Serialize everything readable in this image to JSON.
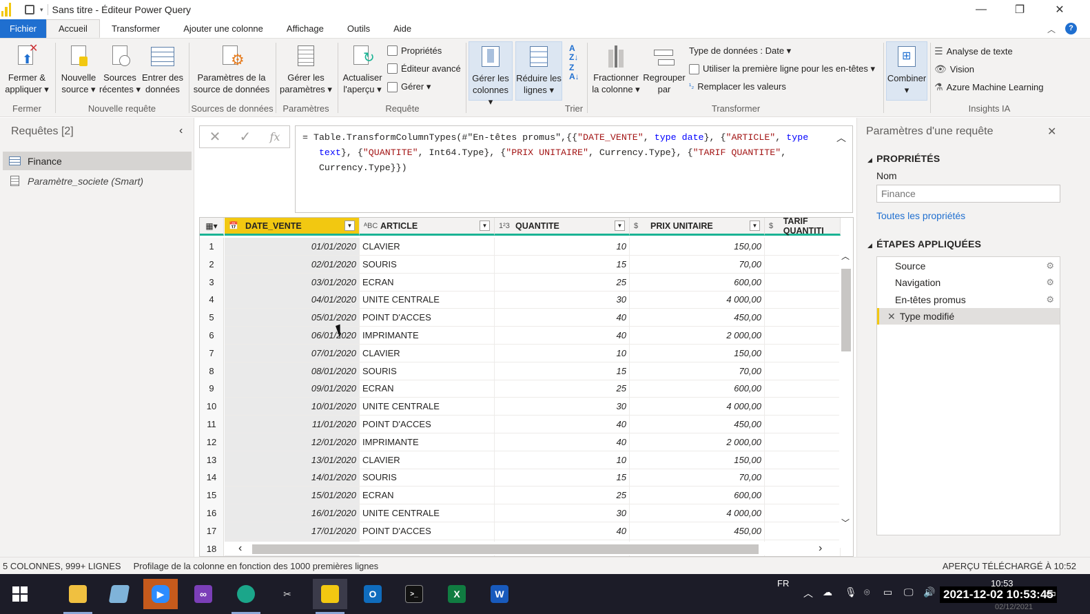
{
  "window": {
    "title": "Sans titre - Éditeur Power Query",
    "save_icon": "save-icon",
    "controls": [
      "minimize",
      "restore",
      "close"
    ]
  },
  "tabs": [
    "Fichier",
    "Accueil",
    "Transformer",
    "Ajouter une colonne",
    "Affichage",
    "Outils",
    "Aide"
  ],
  "ribbon": {
    "close_apply": [
      "Fermer &",
      "appliquer ▾"
    ],
    "new_source": [
      "Nouvelle",
      "source ▾"
    ],
    "recent_sources": [
      "Sources",
      "récentes ▾"
    ],
    "enter_data": [
      "Entrer des",
      "données"
    ],
    "ds_settings": [
      "Paramètres de la",
      "source de données"
    ],
    "manage_params": [
      "Gérer les",
      "paramètres ▾"
    ],
    "refresh_preview": [
      "Actualiser",
      "l'aperçu ▾"
    ],
    "properties": "Propriétés",
    "advanced_editor": "Éditeur avancé",
    "manage": "Gérer ▾",
    "manage_cols": [
      "Gérer les",
      "colonnes ▾"
    ],
    "reduce_rows": [
      "Réduire les",
      "lignes ▾"
    ],
    "split_col": [
      "Fractionner",
      "la colonne ▾"
    ],
    "group_by": [
      "Regrouper",
      "par"
    ],
    "data_type": "Type de données : Date ▾",
    "first_row_headers": "Utiliser la première ligne pour les en-têtes ▾",
    "replace_values": "Remplacer les valeurs",
    "combine": [
      "Combiner",
      "▾"
    ],
    "text_analytics": "Analyse de texte",
    "vision": "Vision",
    "azure_ml": "Azure Machine Learning",
    "groups": {
      "close": "Fermer",
      "new_query": "Nouvelle requête",
      "data_sources": "Sources de données",
      "parameters": "Paramètres",
      "query": "Requête",
      "sort": "Trier",
      "transform": "Transformer",
      "ai_insights": "Insights IA"
    }
  },
  "queries": {
    "header": "Requêtes [2]",
    "items": [
      "Finance",
      "Paramètre_societe (Smart)"
    ]
  },
  "formula": {
    "prefix": "= ",
    "parts": [
      {
        "t": "Table.TransformColumnTypes(#\"En-têtes promus\",{{",
        "c": ""
      },
      {
        "t": "\"DATE_VENTE\"",
        "c": "st"
      },
      {
        "t": ", ",
        "c": ""
      },
      {
        "t": "type date",
        "c": "kw"
      },
      {
        "t": "}, {",
        "c": ""
      },
      {
        "t": "\"ARTICLE\"",
        "c": "st"
      },
      {
        "t": ", ",
        "c": ""
      },
      {
        "t": "type\n   text",
        "c": "kw"
      },
      {
        "t": "}, {",
        "c": ""
      },
      {
        "t": "\"QUANTITE\"",
        "c": "st"
      },
      {
        "t": ", Int64.Type}, {",
        "c": ""
      },
      {
        "t": "\"PRIX UNITAIRE\"",
        "c": "st"
      },
      {
        "t": ", Currency.Type}, {",
        "c": ""
      },
      {
        "t": "\"TARIF QUANTITE\"",
        "c": "st"
      },
      {
        "t": ",\n   Currency.Type}})",
        "c": ""
      }
    ]
  },
  "grid": {
    "columns": [
      {
        "type_icon": "📅",
        "name": "DATE_VENTE"
      },
      {
        "type_icon": "ᴬBC",
        "name": "ARTICLE"
      },
      {
        "type_icon": "1²3",
        "name": "QUANTITE"
      },
      {
        "type_icon": "$",
        "name": "PRIX UNITAIRE"
      },
      {
        "type_icon": "$",
        "name": "TARIF QUANTITI"
      }
    ],
    "rows": [
      [
        "1",
        "01/01/2020",
        "CLAVIER",
        "10",
        "150,00"
      ],
      [
        "2",
        "02/01/2020",
        "SOURIS",
        "15",
        "70,00"
      ],
      [
        "3",
        "03/01/2020",
        "ECRAN",
        "25",
        "600,00"
      ],
      [
        "4",
        "04/01/2020",
        "UNITE CENTRALE",
        "30",
        "4 000,00"
      ],
      [
        "5",
        "05/01/2020",
        "POINT D'ACCES",
        "40",
        "450,00"
      ],
      [
        "6",
        "06/01/2020",
        "IMPRIMANTE",
        "40",
        "2 000,00"
      ],
      [
        "7",
        "07/01/2020",
        "CLAVIER",
        "10",
        "150,00"
      ],
      [
        "8",
        "08/01/2020",
        "SOURIS",
        "15",
        "70,00"
      ],
      [
        "9",
        "09/01/2020",
        "ECRAN",
        "25",
        "600,00"
      ],
      [
        "10",
        "10/01/2020",
        "UNITE CENTRALE",
        "30",
        "4 000,00"
      ],
      [
        "11",
        "11/01/2020",
        "POINT D'ACCES",
        "40",
        "450,00"
      ],
      [
        "12",
        "12/01/2020",
        "IMPRIMANTE",
        "40",
        "2 000,00"
      ],
      [
        "13",
        "13/01/2020",
        "CLAVIER",
        "10",
        "150,00"
      ],
      [
        "14",
        "14/01/2020",
        "SOURIS",
        "15",
        "70,00"
      ],
      [
        "15",
        "15/01/2020",
        "ECRAN",
        "25",
        "600,00"
      ],
      [
        "16",
        "16/01/2020",
        "UNITE CENTRALE",
        "30",
        "4 000,00"
      ],
      [
        "17",
        "17/01/2020",
        "POINT D'ACCES",
        "40",
        "450,00"
      ],
      [
        "18",
        "",
        "",
        "",
        ""
      ]
    ]
  },
  "query_settings": {
    "title": "Paramètres d'une requête",
    "properties_header": "PROPRIÉTÉS",
    "name_label": "Nom",
    "name_placeholder": "Finance",
    "all_properties_link": "Toutes les propriétés",
    "steps_header": "ÉTAPES APPLIQUÉES",
    "steps": [
      "Source",
      "Navigation",
      "En-têtes promus",
      "Type modifié"
    ]
  },
  "status": {
    "left": "5 COLONNES, 999+ LIGNES",
    "profiling": "Profilage de la colonne en fonction des 1000 premières lignes",
    "right": "APERÇU TÉLÉCHARGÉ À 10:52"
  },
  "taskbar": {
    "language": "FR",
    "clock_time": "10:53",
    "clock_overlay": "2021-12-02 10:53:45",
    "clock_date": "02/12/2021"
  },
  "colors": {
    "accent": "#1f6fd0",
    "powerbi_yellow": "#f2c811",
    "header_underline": "#1ab394"
  }
}
